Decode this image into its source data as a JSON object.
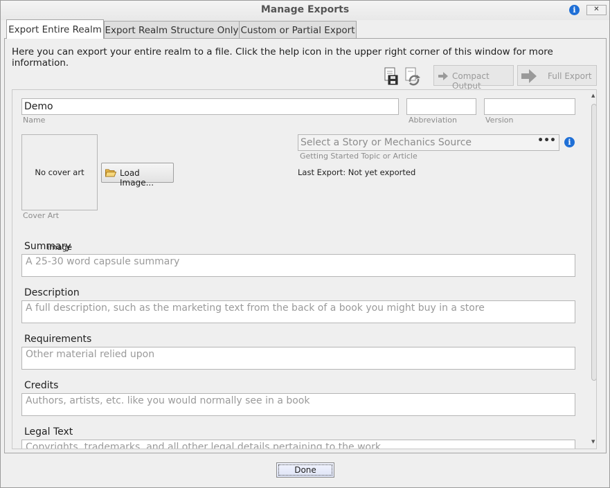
{
  "window": {
    "title": "Manage Exports",
    "help_icon": "info-icon",
    "close_icon": "close-icon"
  },
  "tabs": [
    {
      "label": "Export Entire Realm",
      "active": true
    },
    {
      "label": "Export Realm Structure Only",
      "active": false
    },
    {
      "label": "Custom or Partial Export",
      "active": false
    }
  ],
  "intro_text": "Here you can export your entire realm to a file.  Click the help icon in the upper right corner of this window for more information.",
  "toolbar": {
    "compact_label": "Compact Output",
    "full_label": "Full Export",
    "save_icon": "save-icon",
    "sync_icon": "sync-icon"
  },
  "form": {
    "name": {
      "value": "Demo",
      "caption": "Name"
    },
    "abbreviation": {
      "value": "",
      "caption": "Abbreviation"
    },
    "version": {
      "value": "",
      "caption": "Version"
    },
    "cover": {
      "placeholder": "No cover art image",
      "caption": "Cover Art",
      "load_label": "Load Image..."
    },
    "story": {
      "placeholder": "Select a Story or Mechanics Source",
      "dots": "•••",
      "caption": "Getting Started Topic or Article"
    },
    "last_export": "Last Export: Not yet exported",
    "summary": {
      "label": "Summary",
      "placeholder": "A 25-30 word capsule summary"
    },
    "description": {
      "label": "Description",
      "placeholder": "A full description, such as the marketing text from the back of a book you might buy in a store"
    },
    "requirements": {
      "label": "Requirements",
      "placeholder": "Other material relied upon"
    },
    "credits": {
      "label": "Credits",
      "placeholder": "Authors, artists, etc. like you would normally see in a book"
    },
    "legal": {
      "label": "Legal Text",
      "placeholder": "Copyrights, trademarks, and all other legal details pertaining to the work"
    }
  },
  "done_label": "Done",
  "colors": {
    "accent": "#1f6fd6",
    "panel": "#efefef",
    "border": "#a5a5a5"
  }
}
